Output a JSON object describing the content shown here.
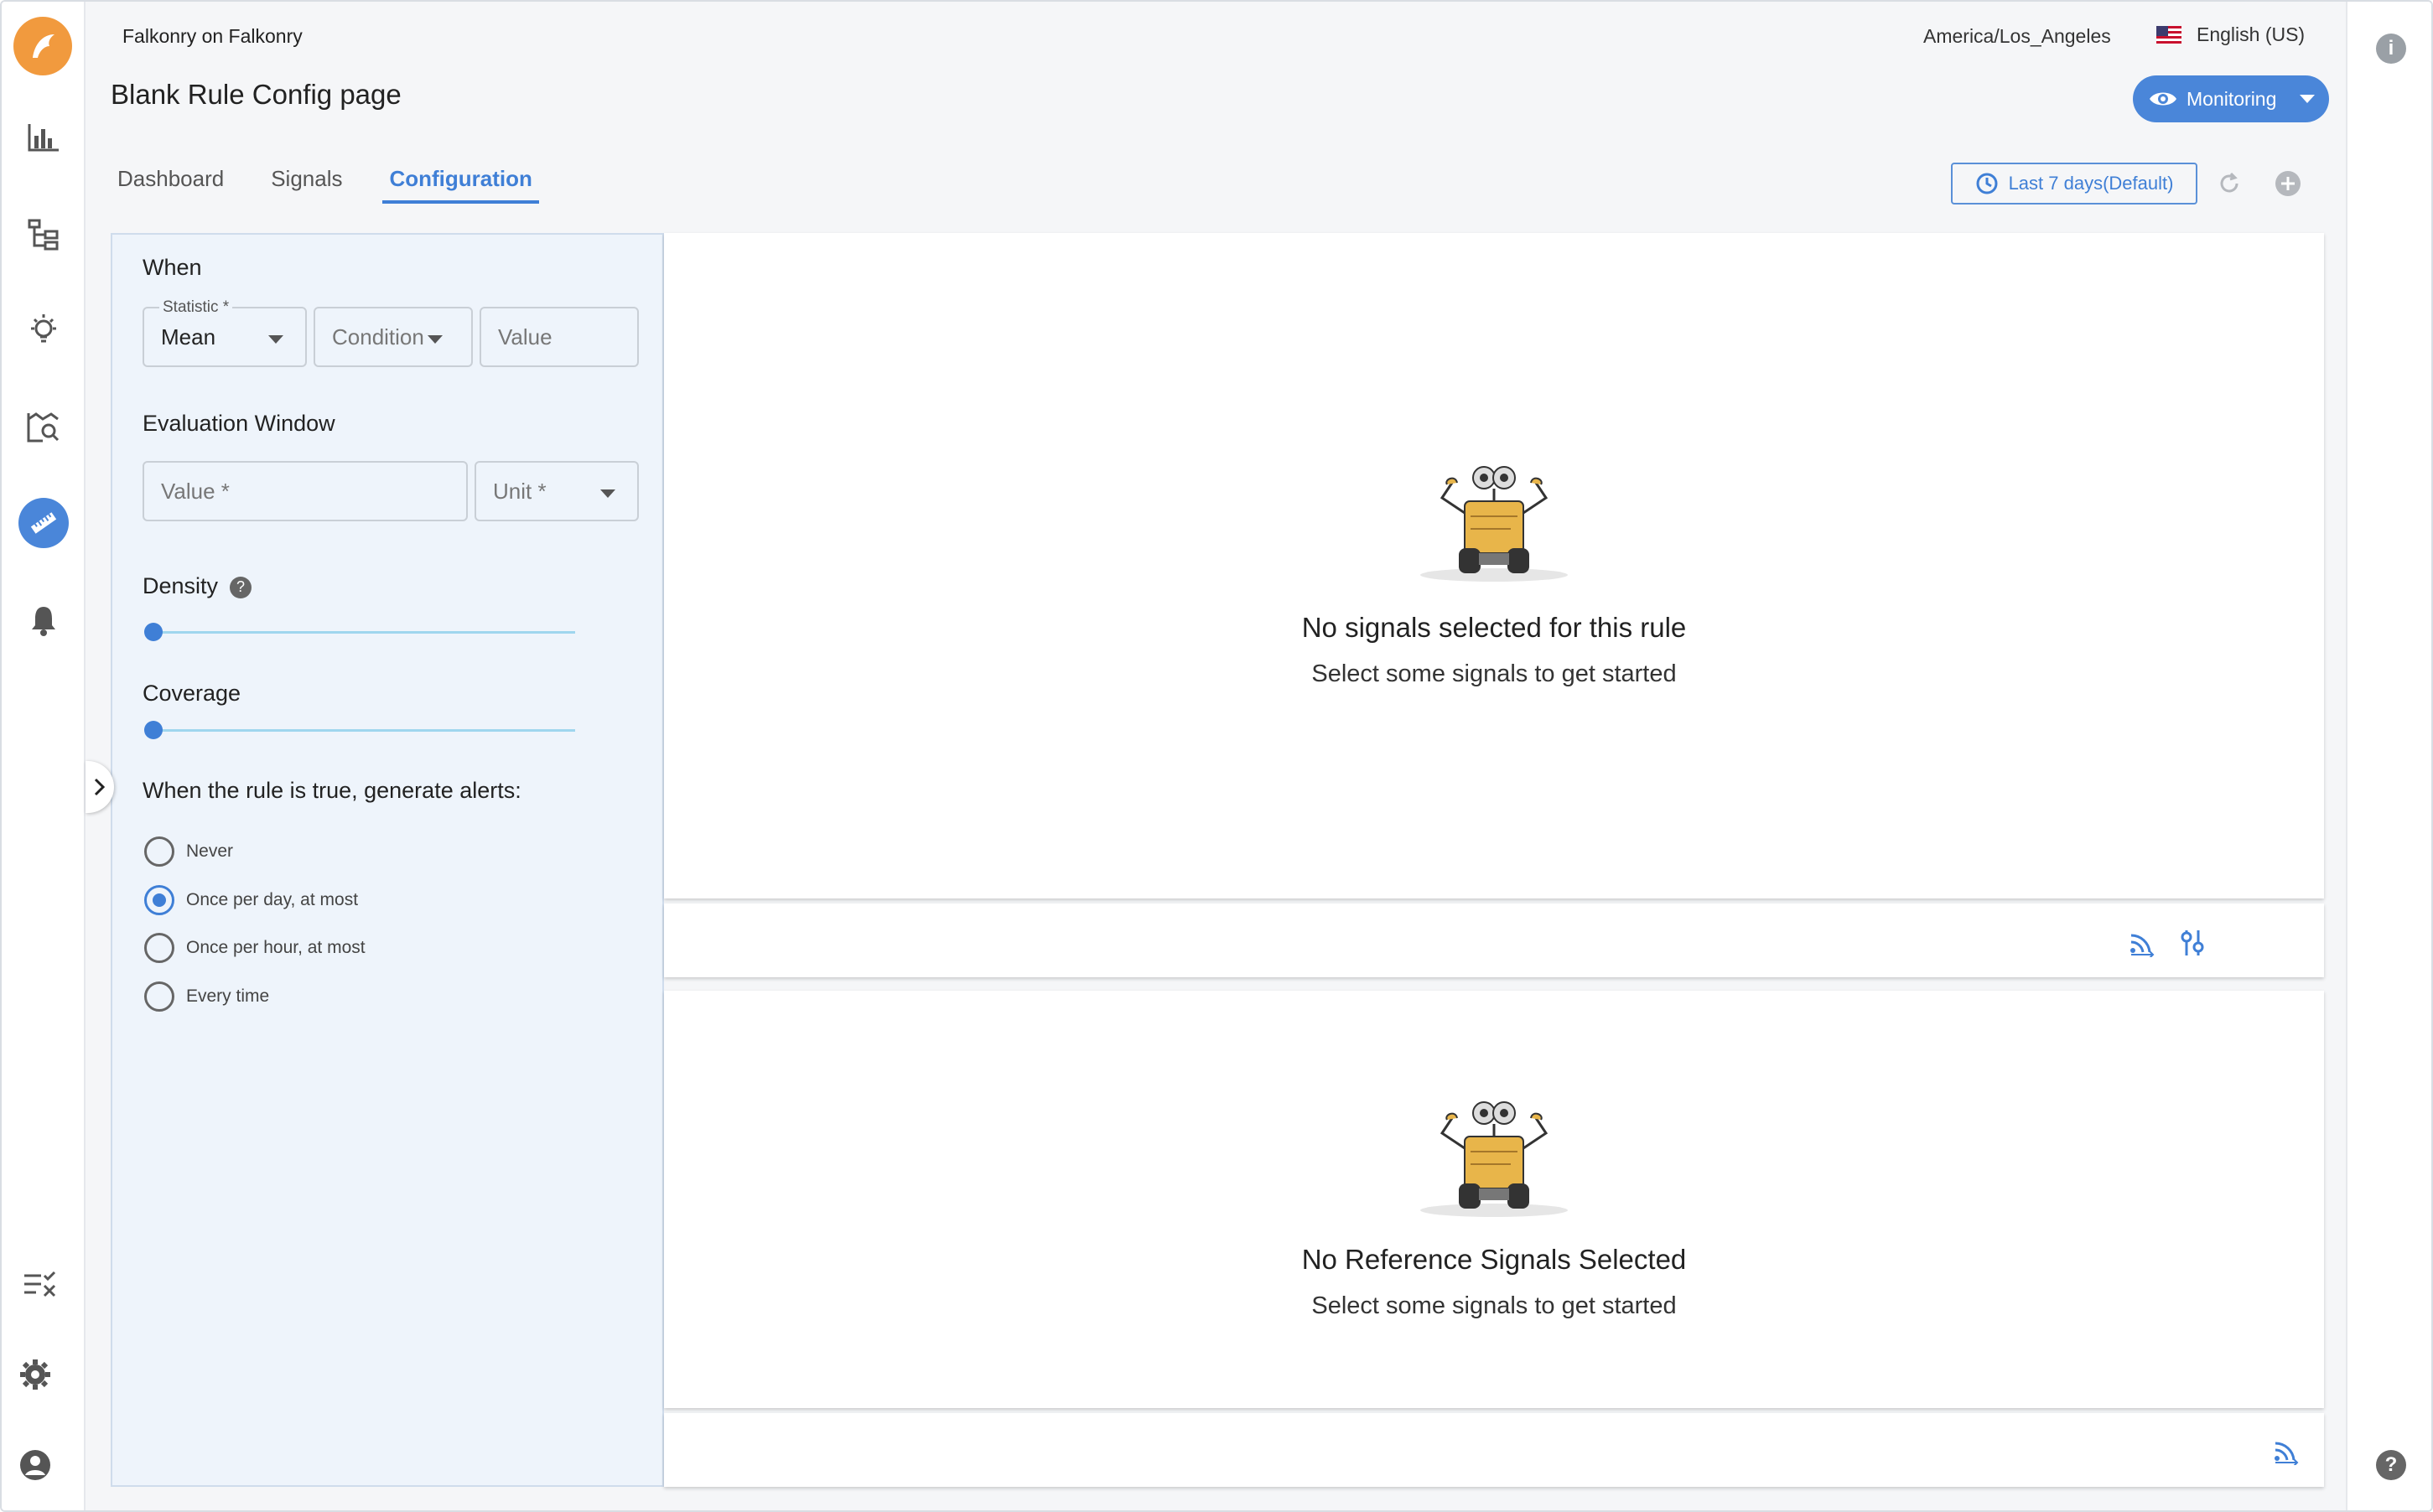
{
  "header": {
    "org_name": "Falkonry on Falkonry",
    "timezone": "America/Los_Angeles",
    "language": "English (US)",
    "page_title": "Blank Rule Config page",
    "monitoring_label": "Monitoring"
  },
  "tabs": [
    {
      "label": "Dashboard",
      "active": false
    },
    {
      "label": "Signals",
      "active": false
    },
    {
      "label": "Configuration",
      "active": true
    }
  ],
  "toolbar": {
    "range_label": "Last 7 days(Default)"
  },
  "rule": {
    "when_title": "When",
    "statistic_label": "Statistic *",
    "statistic_value": "Mean",
    "condition_placeholder": "Condition",
    "value_placeholder": "Value",
    "eval_title": "Evaluation Window",
    "eval_value_placeholder": "Value *",
    "eval_unit_placeholder": "Unit *",
    "density_title": "Density",
    "density_value": 0,
    "coverage_title": "Coverage",
    "coverage_value": 0,
    "alerts_title": "When the rule is true, generate alerts:",
    "alert_options": [
      {
        "label": "Never",
        "checked": false
      },
      {
        "label": "Once per day, at most",
        "checked": true
      },
      {
        "label": "Once per hour, at most",
        "checked": false
      },
      {
        "label": "Every time",
        "checked": false
      }
    ]
  },
  "signals_card": {
    "title": "No signals selected for this rule",
    "subtitle": "Select some signals to get started"
  },
  "reference_card": {
    "title": "No Reference Signals Selected",
    "subtitle": "Select some signals to get started"
  },
  "colors": {
    "accent": "#4a86d9",
    "logo": "#f19a3e",
    "panel_bg": "#eef4fb"
  }
}
